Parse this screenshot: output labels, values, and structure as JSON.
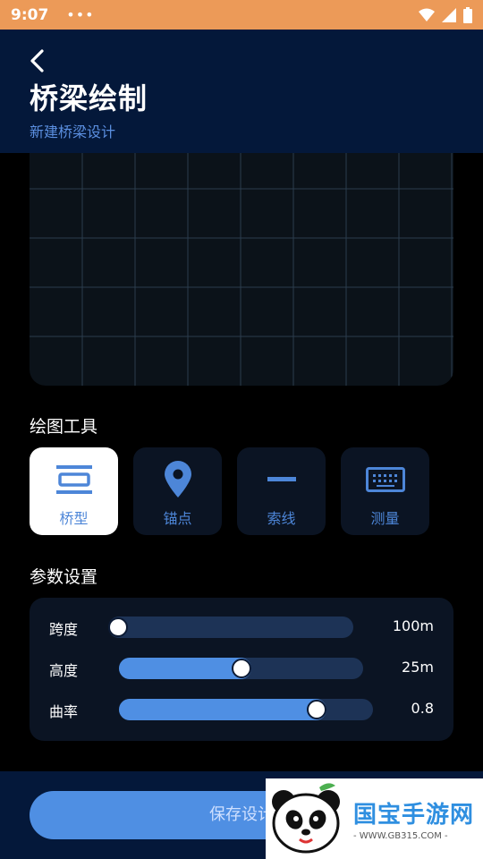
{
  "status_bar": {
    "time": "9:07",
    "dots": "•••"
  },
  "header": {
    "title": "桥梁绘制",
    "subtitle": "新建桥梁设计"
  },
  "sections": {
    "tools_title": "绘图工具",
    "params_title": "参数设置"
  },
  "tools": [
    {
      "label": "桥型",
      "icon": "bridge-type-icon",
      "active": true
    },
    {
      "label": "锚点",
      "icon": "location-pin-icon",
      "active": false
    },
    {
      "label": "索线",
      "icon": "line-icon",
      "active": false
    },
    {
      "label": "测量",
      "icon": "keyboard-icon",
      "active": false
    }
  ],
  "params": [
    {
      "label": "跨度",
      "value": "100m",
      "level": 0.0
    },
    {
      "label": "高度",
      "value": "25m",
      "level": 0.5
    },
    {
      "label": "曲率",
      "value": "0.8",
      "level": 0.8
    }
  ],
  "footer": {
    "save_label": "保存设计"
  },
  "watermark": {
    "name": "国宝手游网",
    "url": "- WWW.GB315.COM -"
  },
  "colors": {
    "accent": "#4f8fe3",
    "header_bg": "#04183a",
    "status_bar": "#ec9a58"
  }
}
